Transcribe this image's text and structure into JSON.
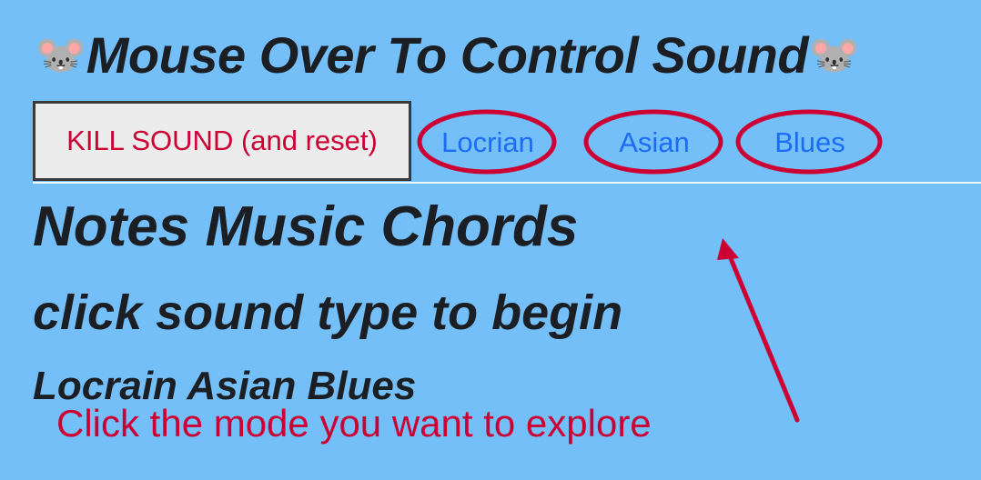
{
  "header": {
    "title": "Mouse Over To Control Sound",
    "left_icon": "mouse-face-icon",
    "right_icon": "mouse-face-icon"
  },
  "controls": {
    "kill_label": "KILL SOUND (and reset)",
    "modes": [
      "Locrian",
      "Asian",
      "Blues"
    ]
  },
  "main": {
    "heading": "Notes Music Chords",
    "subheading": "click sound type to begin",
    "modes_heading": "Locrain Asian Blues"
  },
  "annotation": {
    "text": "Click the mode you want to explore"
  },
  "colors": {
    "background": "#74bff8",
    "accent_red": "#cc0033",
    "link_blue": "#1b6cf5",
    "text_dark": "#1b1f24"
  }
}
